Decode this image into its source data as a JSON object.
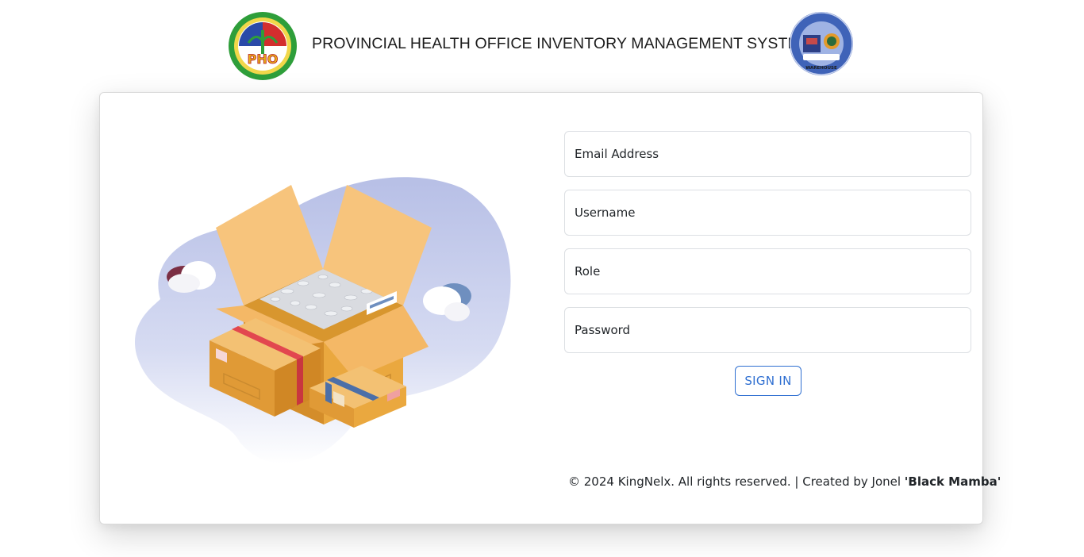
{
  "header": {
    "title": "PROVINCIAL HEALTH OFFICE INVENTORY MANAGEMENT SYSTEM",
    "left_logo": {
      "icon": "pho-seal-logo",
      "text": "PHO"
    },
    "right_logo": {
      "icon": "warehouse-seal-logo",
      "text": "WAREHOUSE"
    }
  },
  "illustration": {
    "icon": "open-cardboard-boxes-illustration"
  },
  "form": {
    "email_placeholder": "Email Address",
    "username_placeholder": "Username",
    "role_placeholder": "Role",
    "password_placeholder": "Password",
    "signin_label": "SIGN IN"
  },
  "footer": {
    "copyright": "© 2024 KingNelx. All rights reserved. | Created by Jonel ",
    "author_nickname": "'Black Mamba'"
  },
  "colors": {
    "accent": "#2f6fd1",
    "box_orange": "#e8a53f",
    "blob_lavender": "#b9c1e6"
  }
}
